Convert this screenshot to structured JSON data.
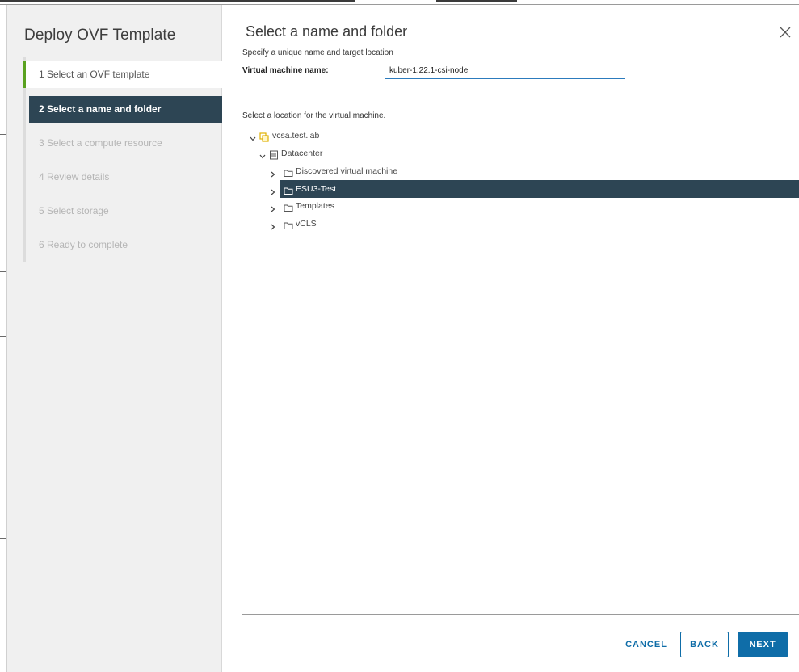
{
  "wizard": {
    "title": "Deploy OVF Template",
    "steps": [
      {
        "label": "1  Select an OVF template",
        "state": "done"
      },
      {
        "label": "2  Select a name and folder",
        "state": "active"
      },
      {
        "label": "3  Select a compute resource",
        "state": "pending"
      },
      {
        "label": "4  Review details",
        "state": "pending"
      },
      {
        "label": "5  Select storage",
        "state": "pending"
      },
      {
        "label": "6  Ready to complete",
        "state": "pending"
      }
    ]
  },
  "main": {
    "title": "Select a name and folder",
    "subtitle": "Specify a unique name and target location",
    "vm_name_label": "Virtual machine name:",
    "vm_name_value": "kuber-1.22.1-csi-node",
    "location_label": "Select a location for the virtual machine."
  },
  "tree": {
    "vcenter": {
      "label": "vcsa.test.lab",
      "icon": "vcenter-icon",
      "expanded": true
    },
    "datacenter": {
      "label": "Datacenter",
      "icon": "datacenter-icon",
      "expanded": true
    },
    "folders": [
      {
        "label": "Discovered virtual machine",
        "icon": "folder-icon",
        "selected": false
      },
      {
        "label": "ESU3-Test",
        "icon": "folder-icon",
        "selected": true
      },
      {
        "label": "Templates",
        "icon": "folder-icon",
        "selected": false
      },
      {
        "label": "vCLS",
        "icon": "folder-icon",
        "selected": false
      }
    ]
  },
  "footer": {
    "cancel_label": "CANCEL",
    "back_label": "BACK",
    "next_label": "NEXT"
  },
  "colors": {
    "accent": "#0f6da8",
    "selected_bg": "#2d4554",
    "done_marker": "#5aa220",
    "vcenter_icon": "#e6b800"
  }
}
